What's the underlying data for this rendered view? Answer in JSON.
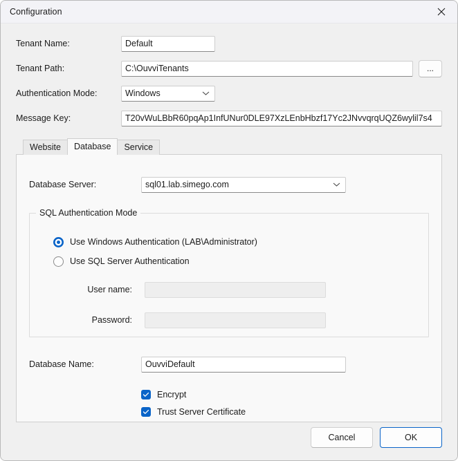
{
  "window": {
    "title": "Configuration",
    "close_icon": "close-icon"
  },
  "colors": {
    "accent": "#0a64c8",
    "window_background": "#f0f0f0",
    "titlebar_background": "#f3f3f7",
    "panel_background": "#f9f9f9",
    "field_background": "#ffffff",
    "disabled_field_background": "#eeeeee",
    "border": "#cfcfcf"
  },
  "form": {
    "tenant_name": {
      "label": "Tenant Name:",
      "value": "Default",
      "placeholder": ""
    },
    "tenant_path": {
      "label": "Tenant Path:",
      "value": "C:\\OuvviTenants",
      "placeholder": "",
      "browse_label": "..."
    },
    "authentication_mode": {
      "label": "Authentication Mode:",
      "value": "Windows",
      "options": [
        "Windows"
      ],
      "chevron_icon": "chevron-down-icon"
    },
    "message_key": {
      "label": "Message Key:",
      "value": "T20vWuLBbR60pqAp1InfUNur0DLE97XzLEnbHbzf17Yc2JNvvqrqUQZ6wylil7s4",
      "placeholder": ""
    }
  },
  "tabs": [
    {
      "label": "Website",
      "active": false
    },
    {
      "label": "Database",
      "active": true
    },
    {
      "label": "Service",
      "active": false
    }
  ],
  "database_tab": {
    "database_server": {
      "label": "Database Server:",
      "value": "sql01.lab.simego.com",
      "options": [
        "sql01.lab.simego.com"
      ],
      "chevron_icon": "chevron-down-icon"
    },
    "sql_auth_group": {
      "title": "SQL Authentication Mode",
      "radios": [
        {
          "label": "Use Windows Authentication (LAB\\Administrator)",
          "checked": true
        },
        {
          "label": "Use SQL Server Authentication",
          "checked": false
        }
      ],
      "user_name": {
        "label": "User name:",
        "value": "",
        "placeholder": "",
        "disabled": true
      },
      "password": {
        "label": "Password:",
        "value": "",
        "placeholder": "",
        "disabled": true
      }
    },
    "database_name": {
      "label": "Database Name:",
      "value": "OuvviDefault",
      "placeholder": ""
    },
    "checkboxes": [
      {
        "label": "Encrypt",
        "checked": true
      },
      {
        "label": "Trust Server Certificate",
        "checked": true
      }
    ]
  },
  "footer": {
    "cancel_label": "Cancel",
    "ok_label": "OK"
  }
}
